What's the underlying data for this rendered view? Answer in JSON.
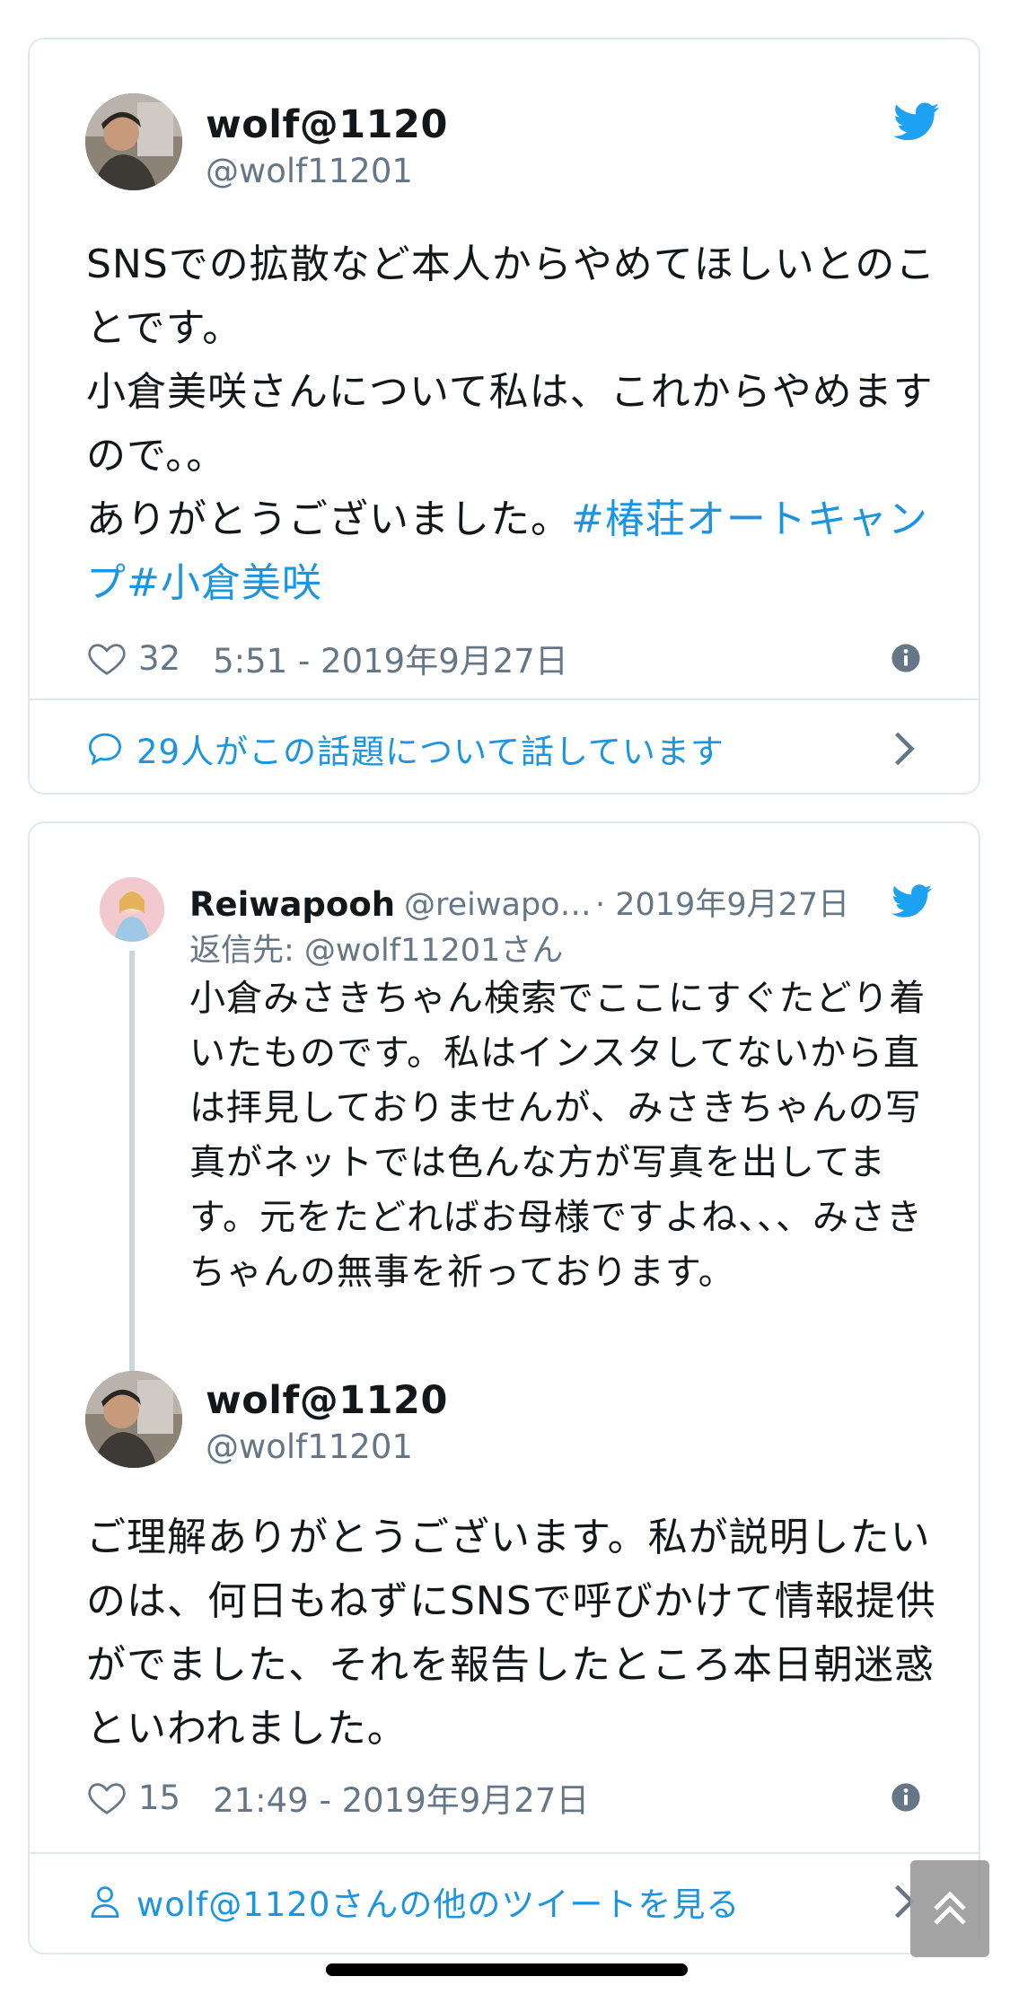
{
  "tweet1": {
    "author_name": "wolf@1120",
    "author_handle": "@wolf11201",
    "text": "SNSでの拡散など本人からやめてほしいとのことです。\n小倉美咲さんについて私は、これからやめますので。。\nありがとうございました。",
    "hashtag1": "#椿荘オートキャンプ",
    "hashtag2": "#小倉美咲",
    "likes": "32",
    "timestamp": "5:51 - 2019年9月27日",
    "conversation_label": "29人がこの話題について話しています"
  },
  "tweet2": {
    "reply": {
      "name": "Reiwapooh",
      "handle": "@reiwapo…",
      "date": "· 2019年9月27日",
      "reply_to": "返信先: @wolf11201さん",
      "text": "小倉みさきちゃん検索でここにすぐたどり着いたものです。私はインスタしてないから直は拝見しておりませんが、みさきちゃんの写真がネットでは色んな方が写真を出してます。元をたどればお母様ですよね、、、みさきちゃんの無事を祈っております。"
    },
    "author_name": "wolf@1120",
    "author_handle": "@wolf11201",
    "text": "ご理解ありがとうございます。私が説明したいのは、何日もねずにSNSで呼びかけて情報提供がでました、それを報告したところ本日朝迷惑といわれました。",
    "likes": "15",
    "timestamp": "21:49 - 2019年9月27日",
    "more_tweets_label": "wolf@1120さんの他のツイートを見る"
  },
  "colors": {
    "accent": "#1b95e0",
    "secondary_text": "#657786",
    "border": "#e1e8ed"
  },
  "icons": [
    "twitter-bird-icon",
    "heart-icon",
    "info-icon",
    "speech-bubble-icon",
    "chevron-right-icon",
    "person-icon",
    "double-chevron-up-icon"
  ]
}
